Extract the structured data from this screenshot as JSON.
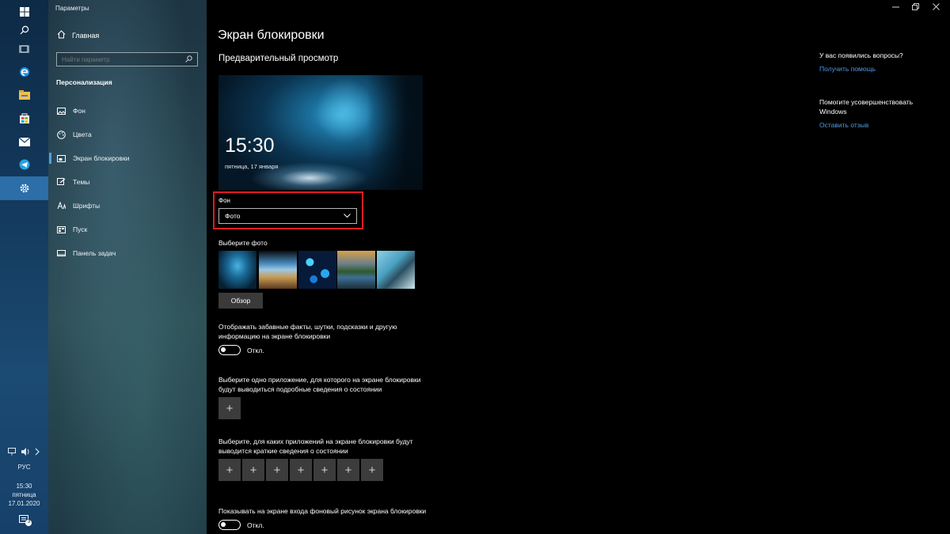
{
  "window": {
    "title": "Параметры"
  },
  "nav": {
    "home_label": "Главная",
    "search_placeholder": "Найти параметр",
    "section_title": "Персонализация",
    "items": [
      {
        "label": "Фон",
        "icon": "picture-icon"
      },
      {
        "label": "Цвета",
        "icon": "palette-icon"
      },
      {
        "label": "Экран блокировки",
        "icon": "lock-screen-icon",
        "selected": true
      },
      {
        "label": "Темы",
        "icon": "brush-icon"
      },
      {
        "label": "Шрифты",
        "icon": "font-icon"
      },
      {
        "label": "Пуск",
        "icon": "start-icon"
      },
      {
        "label": "Панель задач",
        "icon": "taskbar-icon"
      }
    ]
  },
  "main": {
    "title": "Экран блокировки",
    "preview_title": "Предварительный просмотр",
    "preview_time": "15:30",
    "preview_date": "пятница, 17 января",
    "background_label": "Фон",
    "background_value": "Фото",
    "choose_photo_label": "Выберите фото",
    "browse_label": "Обзор",
    "fun_facts_text": "Отображать забавные факты, шутки, подсказки и другую информацию на экране блокировки",
    "fun_facts_state": "Откл.",
    "detailed_app_text": "Выберите одно приложение, для которого на экране блокировки будут выводиться подробные сведения о состоянии",
    "quick_apps_text": "Выберите, для каких приложений на экране блокировки будут выводится краткие сведения о состоянии",
    "signin_bg_text": "Показывать на экране входа фоновый рисунок экрана блокировки",
    "signin_bg_state": "Откл."
  },
  "side": {
    "question": "У вас появились вопросы?",
    "help_link": "Получить помощь",
    "improve": "Помогите усовершенствовать Windows",
    "feedback_link": "Оставить отзыв"
  },
  "taskbar": {
    "lang": "РУС",
    "time": "15:30",
    "day": "пятница",
    "date": "17.01.2020",
    "notifications_count": "3"
  },
  "colors": {
    "accent": "#4a9be3",
    "highlight_box": "#e21b22",
    "active_tb": "#2b6ea8"
  }
}
